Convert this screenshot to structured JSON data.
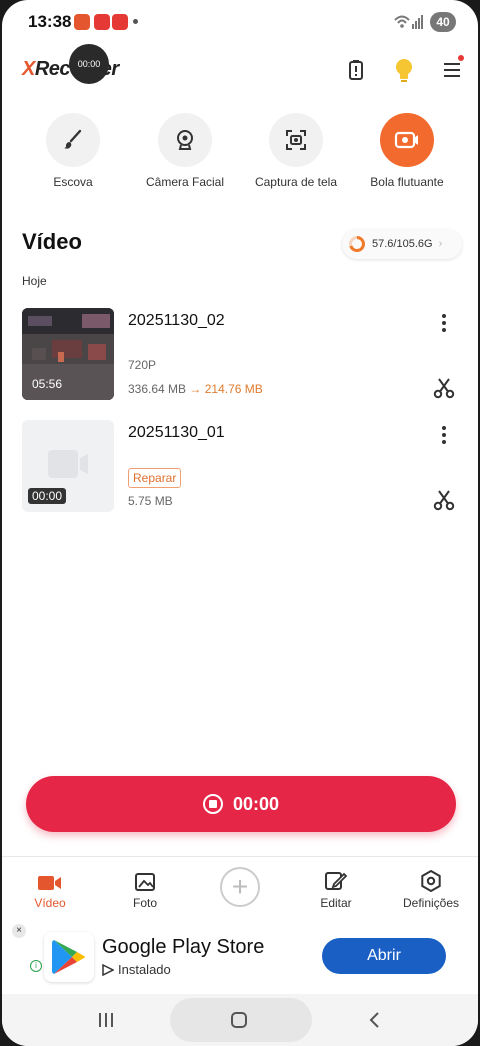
{
  "status_bar": {
    "time": "13:38",
    "battery": "40"
  },
  "floating_recorder": {
    "time": "00:00"
  },
  "header": {
    "logo_x": "X",
    "logo_rest": "Recorder"
  },
  "tools": [
    {
      "label": "Escova",
      "icon": "brush-icon"
    },
    {
      "label": "Câmera Facial",
      "icon": "webcam-icon"
    },
    {
      "label": "Captura de tela",
      "icon": "screenshot-icon"
    },
    {
      "label": "Bola flutuante",
      "icon": "floating-ball-icon"
    }
  ],
  "section": {
    "title": "Vídeo",
    "storage": "57.6/105.6G",
    "date_group": "Hoje"
  },
  "videos": [
    {
      "title": "20251130_02",
      "duration": "05:56",
      "resolution": "720P",
      "size_old": "336.64 MB",
      "arrow": "→",
      "size_new": "214.76 MB"
    },
    {
      "title": "20251130_01",
      "duration": "00:00",
      "repair": "Reparar",
      "size": "5.75 MB"
    }
  ],
  "record_button": {
    "time": "00:00"
  },
  "bottom_nav": [
    {
      "label": "Vídeo",
      "icon": "video-camera-icon"
    },
    {
      "label": "Foto",
      "icon": "photo-icon"
    },
    {
      "label": "Editar",
      "icon": "edit-icon"
    },
    {
      "label": "Definições",
      "icon": "settings-icon"
    }
  ],
  "ad": {
    "title": "Google Play Store",
    "subtitle": "Instalado",
    "button": "Abrir",
    "close": "×",
    "info": "i"
  },
  "colors": {
    "accent": "#e4572e",
    "record": "#e52646",
    "ad_button": "#1a5fc4"
  }
}
